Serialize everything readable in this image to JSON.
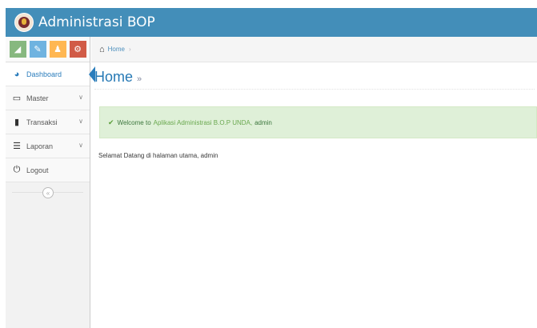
{
  "app": {
    "title": "Administrasi BOP"
  },
  "sidebar": {
    "shortcuts": [
      {
        "icon": "signal-icon"
      },
      {
        "icon": "pencil-icon"
      },
      {
        "icon": "group-icon"
      },
      {
        "icon": "cogs-icon"
      }
    ],
    "items": [
      {
        "label": "Dashboard",
        "icon": "dashboard-icon",
        "active": true
      },
      {
        "label": "Master",
        "icon": "desktop-icon",
        "has_caret": true
      },
      {
        "label": "Transaksi",
        "icon": "book-icon",
        "has_caret": true
      },
      {
        "label": "Laporan",
        "icon": "list-icon",
        "has_caret": true
      },
      {
        "label": "Logout",
        "icon": "power-icon"
      }
    ]
  },
  "breadcrumb": {
    "home_label": "Home",
    "separator": "›"
  },
  "page": {
    "title": "Home",
    "title_arrow": "»"
  },
  "alert": {
    "prefix": "Welcome to",
    "highlight": "Aplikasi Administrasi B.O.P UNDA,",
    "suffix": "admin"
  },
  "welcome_text": "Selamat Datang di halaman utama, admin",
  "colors": {
    "navbar": "#438eb9",
    "accent": "#2679b5",
    "alert_bg": "#dff0d8"
  }
}
